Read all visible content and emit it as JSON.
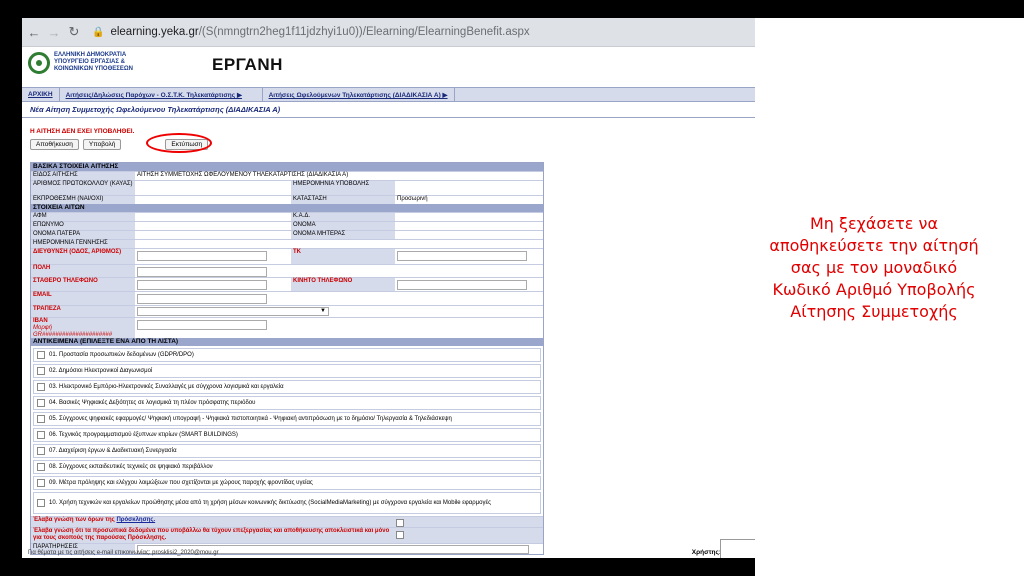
{
  "browser": {
    "url_domain": "elearning.yeka.gr",
    "url_path": "/(S(nmngtrn2heg1f11jdzhyi1u0))/Elearning/ElearningBenefit.aspx"
  },
  "banner": {
    "ministry_lines": [
      "ΕΛΛΗΝΙΚΗ ΔΗΜΟΚΡΑΤΙΑ",
      "ΥΠΟΥΡΓΕΙΟ ΕΡΓΑΣΙΑΣ &",
      "ΚΟΙΝΩΝΙΚΩΝ ΥΠΟΘΕΣΕΩΝ"
    ],
    "logo_text": "ΕΡΓΑΝΗ"
  },
  "nav_tabs": [
    "ΑΡΧΙΚΗ",
    "Αιτήσεις/Δηλώσεις Παρόχων - Ο.Σ.Τ.Κ. Τηλεκατάρτισης ▶",
    "Αιτήσεις Ωφελούμενων Τηλεκατάρτισης (ΔΙΑΔΙΚΑΣΙΑ Α) ▶"
  ],
  "page_title": "Νέα Αίτηση Συμμετοχής Ωφελούμενου Τηλεκατάρτισης (ΔΙΑΔΙΚΑΣΙΑ Α)",
  "warning": "Η ΑΙΤΗΣΗ ΔΕΝ ΕΧΕΙ ΥΠΟΒΛΗΘΕΙ.",
  "buttons": {
    "save": "Αποθήκευση",
    "submit": "Υποβολή",
    "print": "Εκτύπωση"
  },
  "basic": {
    "header": "ΒΑΣΙΚΑ ΣΤΟΙΧΕΙΑ ΑΙΤΗΣΗΣ",
    "type_label": "ΕΙΔΟΣ ΑΙΤΗΣΗΣ",
    "type_value": "ΑΙΤΗΣΗ ΣΥΜΜΕΤΟΧΗΣ ΩΦΕΛΟΥΜΕΝΟΥ ΤΗΛΕΚΑΤΑΡΤΙΣΗΣ (ΔΙΑΔΙΚΑΣΙΑ Α)",
    "protocol_label": "ΑΡΙΘΜΟΣ ΠΡΩΤΟΚΟΛΛΟΥ (ΚΑΥΑΣ)",
    "submit_date_label": "ΗΜΕΡΟΜΗΝΙΑ ΥΠΟΒΟΛΗΣ",
    "late_label": "ΕΚΠΡΟΘΕΣΜΗ (ΝΑΙ/ΟΧΙ)",
    "status_label": "ΚΑΤΑΣΤΑΣΗ",
    "status_value": "Προσωρινή"
  },
  "person": {
    "header": "ΣΤΟΙΧΕΙΑ ΑΙΤΩΝ",
    "afm": "ΑΦΜ",
    "kad": "Κ.Α.Δ.",
    "surname": "ΕΠΩΝΥΜΟ",
    "name": "ΟΝΟΜΑ",
    "father": "ΟΝΟΜΑ ΠΑΤΕΡΑ",
    "mother": "ΟΝΟΜΑ ΜΗΤΕΡΑΣ",
    "birth": "ΗΜΕΡΟΜΗΝΙΑ ΓΕΝΝΗΣΗΣ",
    "address": "ΔΙΕΥΘΥΝΣΗ (ΟΔΟΣ, ΑΡΙΘΜΟΣ)",
    "tk": "ΤΚ",
    "city": "ΠΟΛΗ",
    "phone": "ΣΤΑΘΕΡΟ ΤΗΛΕΦΩΝΟ",
    "mobile": "ΚΙΝΗΤΟ ΤΗΛΕΦΩΝΟ",
    "email": "EMAIL",
    "bank": "ΤΡΑΠΕΖΑ",
    "iban": "IBAN",
    "iban_format_1": "Μορφή",
    "iban_format_2": "GR#####################"
  },
  "subjects": {
    "header": "ΑΝΤΙΚΕΙΜΕΝΑ (ΕΠΙΛΕΞΤΕ ΕΝΑ ΑΠΟ ΤΗ ΛΙΣΤΑ)",
    "items": [
      "01. Προστασία προσωπικών δεδομένων (GDPR/DPO)",
      "02. Δημόσιοι Ηλεκτρονικοί Διαγωνισμοί",
      "03. Ηλεκτρονικό Εμπόριο-Ηλεκτρονικές Συναλλαγές με σύγχρονα λογισμικά και εργαλεία",
      "04. Βασικές Ψηφιακές Δεξιότητες σε λογισμικά τη πλέον πρόσφατης περιόδου",
      "05. Σύγχρονες ψηφιακές εφαρμογές/ Ψηφιακή υπογραφή - Ψηφιακά πιστοποιητικά - Ψηφιακή αντιπρόσωση με το δημόσιο/ Τηλεργασία & Τηλεδιάσκεψη",
      "06. Τεχνικός προγραμματισμού έξυπνων κτιρίων (SMART BUILDINGS)",
      "07. Διαχείριση έργων & Διαδικτυακή Συνεργασία",
      "08. Σύγχρονες εκπαιδευτικές τεχνικές σε ψηφιακό περιβάλλον",
      "09. Μέτρα πρόληψης και ελέγχου λοιμώξεων που σχετίζονται με χώρους παροχής φροντίδας υγείας",
      "10. Χρήση τεχνικών και εργαλείων προώθησης μέσα από τη χρήση μέσων κοινωνικής δικτύωσης (SocialMediaMarketing) με σύγχρονα εργαλεία και Mobile εφαρμογές"
    ]
  },
  "consent": {
    "terms_prefix": "Έλαβα γνώση των όρων της ",
    "terms_link": "Πρόσκλησης.",
    "data_text": "Έλαβα γνώση ότι τα προσωπικά δεδομένα που υποβάλλω θα τύχουν επεξεργασίας και αποθήκευσης αποκλειστικά και μόνο για τους σκοπούς της παρούσας Πρόσκλησης.",
    "remarks": "ΠΑΡΑΤΗΡΗΣΕΙΣ"
  },
  "footer": {
    "left": "Για θέματα με τις αιτήσεις e-mail επικοινωνίας: prosklisi2_2020@mou.gr",
    "right": "Χρήστης:"
  },
  "note": "Μη ξεχάσετε να αποθηκεύσετε την αίτησή σας με τον μοναδικό Κωδικό Αριθμό Υποβολής Αίτησης Συμμετοχής",
  "colors": {
    "note": "#e00000",
    "section": "#9aa6cc",
    "label_bg": "#d6dbeb"
  }
}
